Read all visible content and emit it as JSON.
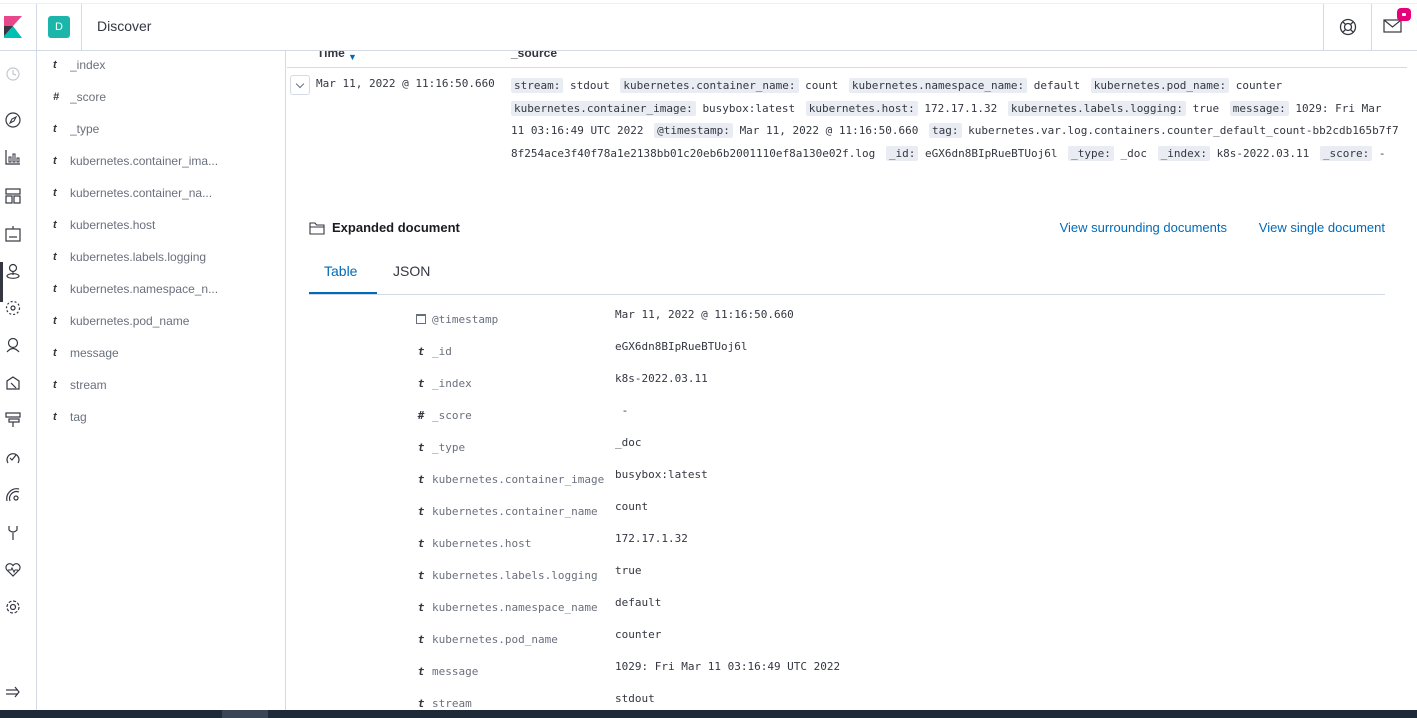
{
  "header": {
    "space_initial": "D",
    "app_title": "Discover",
    "icons": [
      "kibana-logo",
      "help-icon",
      "mail-icon",
      "notification-dot"
    ]
  },
  "nav": {
    "icons": [
      "clock-icon",
      "discover-compass-icon",
      "visualize-icon",
      "dashboard-icon",
      "canvas-icon",
      "maps-icon",
      "ml-icon",
      "graph-icon",
      "siem-icon",
      "logs-icon",
      "apm-icon",
      "uptime-icon",
      "dev-tools-icon",
      "monitoring-icon",
      "management-gear-icon",
      "collapse-nav-icon"
    ]
  },
  "fields": [
    {
      "type": "t",
      "name": "_index"
    },
    {
      "type": "#",
      "name": "_score"
    },
    {
      "type": "t",
      "name": "_type"
    },
    {
      "type": "t",
      "name": "kubernetes.container_ima..."
    },
    {
      "type": "t",
      "name": "kubernetes.container_na..."
    },
    {
      "type": "t",
      "name": "kubernetes.host"
    },
    {
      "type": "t",
      "name": "kubernetes.labels.logging"
    },
    {
      "type": "t",
      "name": "kubernetes.namespace_n..."
    },
    {
      "type": "t",
      "name": "kubernetes.pod_name"
    },
    {
      "type": "t",
      "name": "message"
    },
    {
      "type": "t",
      "name": "stream"
    },
    {
      "type": "t",
      "name": "tag"
    }
  ],
  "table": {
    "col_time": "Time",
    "col_source": "_source",
    "row": {
      "time": "Mar 11, 2022 @ 11:16:50.660",
      "source": [
        {
          "k": "stream:",
          "v": "stdout"
        },
        {
          "k": "kubernetes.container_name:",
          "v": "count"
        },
        {
          "k": "kubernetes.namespace_name:",
          "v": "default"
        },
        {
          "k": "kubernetes.pod_name:",
          "v": "counter"
        },
        {
          "k": "kubernetes.container_image:",
          "v": "busybox:latest"
        },
        {
          "k": "kubernetes.host:",
          "v": "172.17.1.32"
        },
        {
          "k": "kubernetes.labels.logging:",
          "v": "true"
        },
        {
          "k": "message:",
          "v": "1029: Fri Mar 11 03:16:49 UTC 2022"
        },
        {
          "k": "@timestamp:",
          "v": "Mar 11, 2022 @ 11:16:50.660"
        },
        {
          "k": "tag:",
          "v": "kubernetes.var.log.containers.counter_default_count-bb2cdb165b7f78f254ace3f40f78a1e2138bb01c20eb6b2001110ef8a130e02f.log"
        },
        {
          "k": "_id:",
          "v": "eGX6dn8BIpRueBTUoj6l"
        },
        {
          "k": "_type:",
          "v": "_doc"
        },
        {
          "k": "_index:",
          "v": "k8s-2022.03.11"
        },
        {
          "k": "_score:",
          "v": "-"
        }
      ]
    }
  },
  "expanded": {
    "title": "Expanded document",
    "link_surrounding": "View surrounding documents",
    "link_single": "View single document",
    "tab_table": "Table",
    "tab_json": "JSON",
    "rows": [
      {
        "type": "cal",
        "name": "@timestamp",
        "value": "Mar 11, 2022 @ 11:16:50.660"
      },
      {
        "type": "t",
        "name": "_id",
        "value": "eGX6dn8BIpRueBTUoj6l"
      },
      {
        "type": "t",
        "name": "_index",
        "value": "k8s-2022.03.11"
      },
      {
        "type": "#",
        "name": "_score",
        "value": " -"
      },
      {
        "type": "t",
        "name": "_type",
        "value": "_doc"
      },
      {
        "type": "t",
        "name": "kubernetes.container_image",
        "value": "busybox:latest"
      },
      {
        "type": "t",
        "name": "kubernetes.container_name",
        "value": "count"
      },
      {
        "type": "t",
        "name": "kubernetes.host",
        "value": "172.17.1.32"
      },
      {
        "type": "t",
        "name": "kubernetes.labels.logging",
        "value": "true"
      },
      {
        "type": "t",
        "name": "kubernetes.namespace_name",
        "value": "default"
      },
      {
        "type": "t",
        "name": "kubernetes.pod_name",
        "value": "counter"
      },
      {
        "type": "t",
        "name": "message",
        "value": "1029: Fri Mar 11 03:16:49 UTC 2022"
      },
      {
        "type": "t",
        "name": "stream",
        "value": "stdout"
      }
    ]
  },
  "colors": {
    "accent": "#006bb8",
    "space_badge": "#1bb5a9",
    "notification": "#e6007a"
  }
}
